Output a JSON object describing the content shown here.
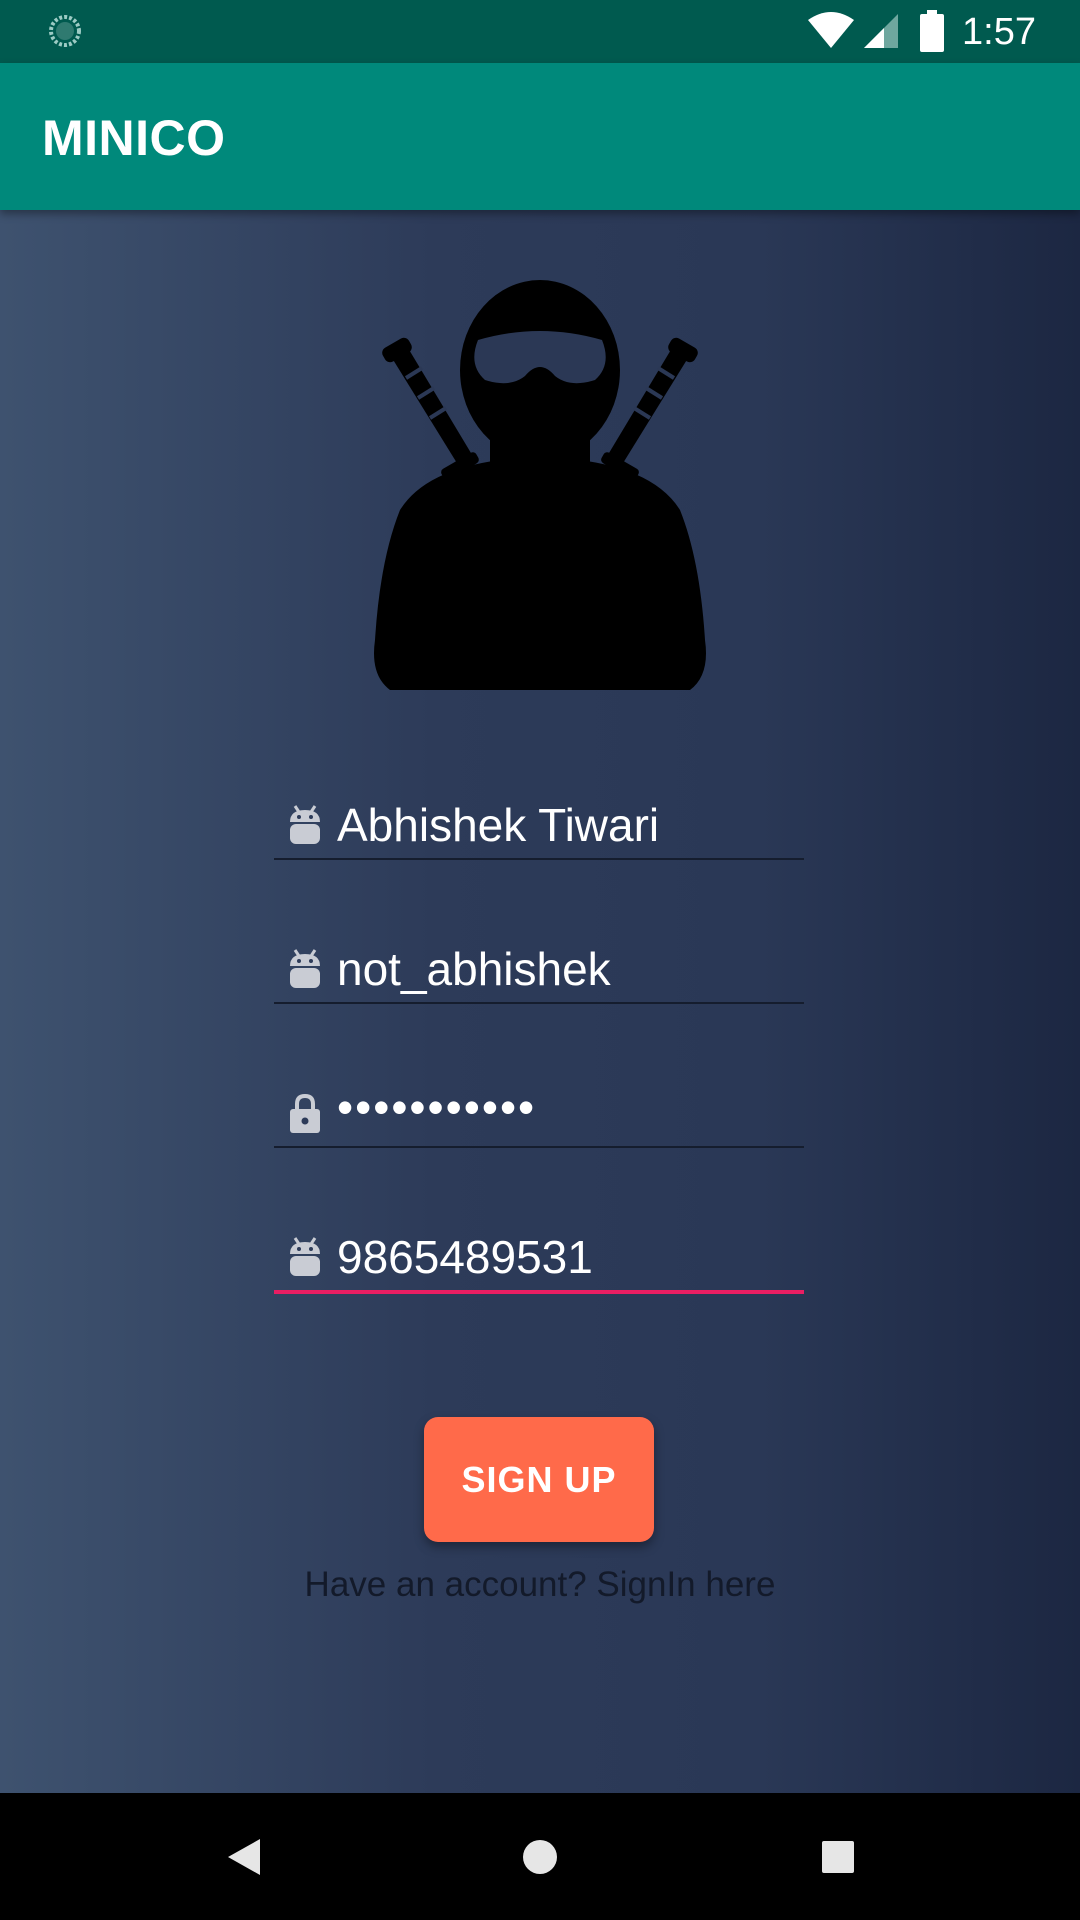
{
  "status_bar": {
    "time": "1:57",
    "icons": [
      "loading-spinner-icon",
      "wifi-icon",
      "cell-signal-icon",
      "battery-icon"
    ]
  },
  "app_bar": {
    "title": "MINICO"
  },
  "form": {
    "avatar_icon": "ninja-avatar-icon",
    "fields": [
      {
        "icon": "android-icon",
        "value": "Abhishek Tiwari"
      },
      {
        "icon": "android-icon",
        "value": "not_abhishek"
      },
      {
        "icon": "lock-icon",
        "value": "•••••••••••"
      },
      {
        "icon": "android-icon",
        "value": "9865489531",
        "focused": true
      }
    ],
    "signup_label": "SIGN UP",
    "signin_link": "Have an account? SignIn here"
  },
  "nav_bar": {
    "icons": [
      "back-icon",
      "home-icon",
      "recents-icon"
    ]
  },
  "colors": {
    "status_bar": "#005a4f",
    "app_bar": "#00897b",
    "accent": "#e91e63",
    "button": "#ff6a4a"
  }
}
